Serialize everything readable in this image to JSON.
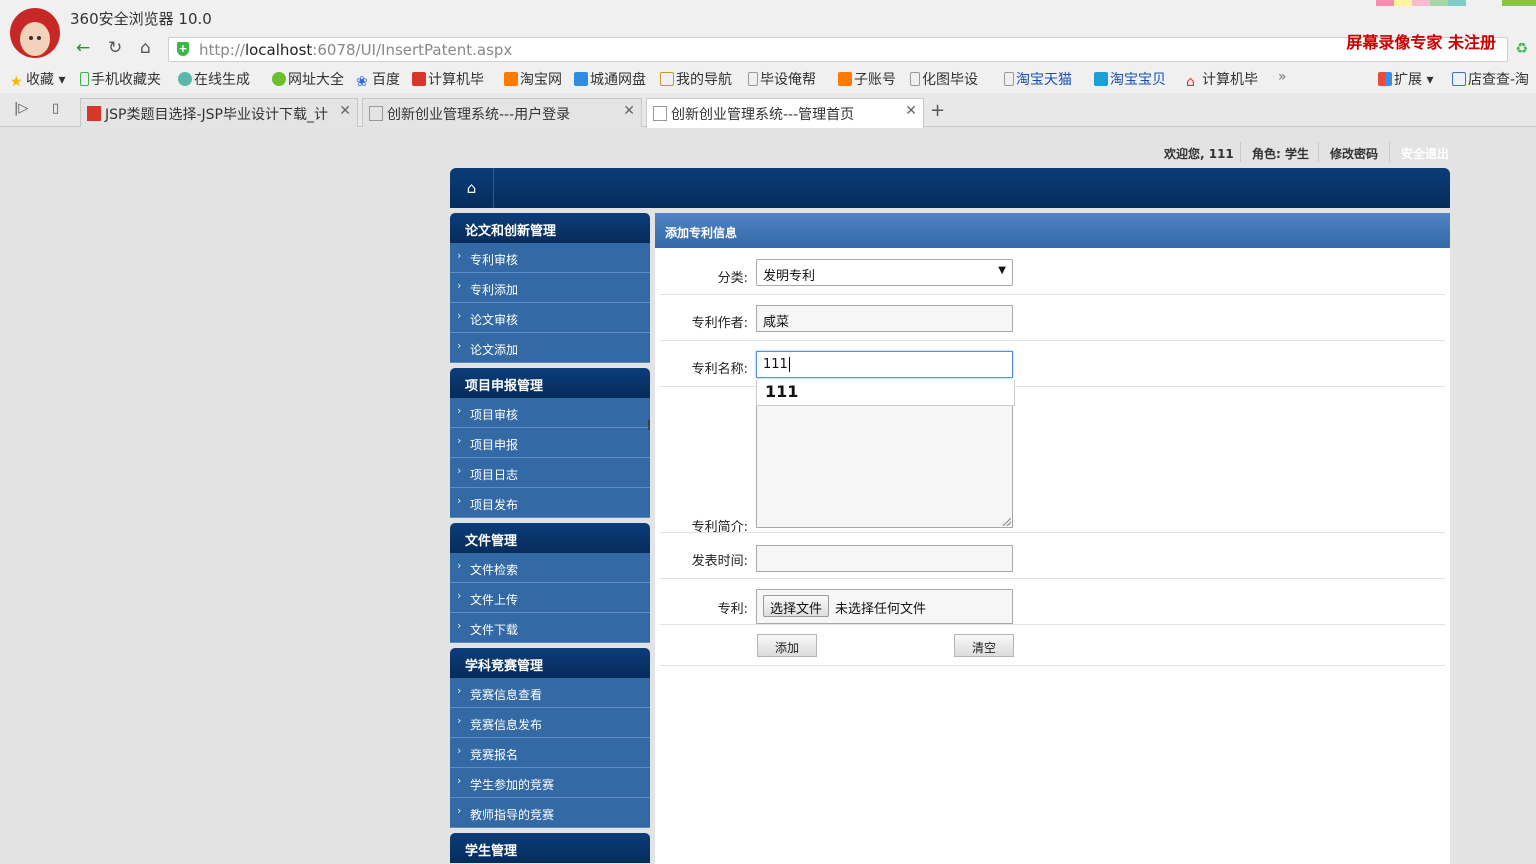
{
  "browser": {
    "title": "360安全浏览器 10.0",
    "url_protocol": "http://",
    "url_host": "localhost",
    "url_path": ":6078/UI/InsertPatent.aspx",
    "recorder_watermark": "屏幕录像专家  未注册",
    "bookmarks": [
      "收藏",
      "手机收藏夹",
      "在线生成",
      "网址大全",
      "百度",
      "计算机毕",
      "淘宝网",
      "城通网盘",
      "我的导航",
      "毕设俺帮",
      "子账号",
      "化图毕设",
      "淘宝天猫",
      "淘宝宝贝",
      "计算机毕",
      "扩展",
      "店查查-淘"
    ],
    "more_label": "»",
    "tabs": [
      {
        "label": "JSP类题目选择-JSP毕业设计下载_计"
      },
      {
        "label": "创新创业管理系统---用户登录"
      },
      {
        "label": "创新创业管理系统---管理首页"
      }
    ]
  },
  "topinfo": {
    "welcome": "欢迎您, 111",
    "role": "角色: 学生",
    "change_password": "修改密码",
    "logout": "安全退出"
  },
  "sidebar": {
    "groups": [
      {
        "title": "论文和创新管理",
        "items": [
          "专利审核",
          "专利添加",
          "论文审核",
          "论文添加"
        ]
      },
      {
        "title": "项目申报管理",
        "items": [
          "项目审核",
          "项目申报",
          "项目日志",
          "项目发布"
        ]
      },
      {
        "title": "文件管理",
        "items": [
          "文件检索",
          "文件上传",
          "文件下载"
        ]
      },
      {
        "title": "学科竞赛管理",
        "items": [
          "竞赛信息查看",
          "竞赛信息发布",
          "竞赛报名",
          "学生参加的竞赛",
          "教师指导的竞赛"
        ]
      },
      {
        "title": "学生管理",
        "items": []
      }
    ]
  },
  "form": {
    "title": "添加专利信息",
    "category_label": "分类:",
    "category_value": "发明专利",
    "author_label": "专利作者:",
    "author_value": "咸菜",
    "name_label": "专利名称:",
    "name_value": "111",
    "name_suggestion": "111",
    "intro_label": "专利简介:",
    "publish_label": "发表时间:",
    "file_label": "专利:",
    "file_button": "选择文件",
    "file_status": "未选择任何文件",
    "add_button": "添加",
    "clear_button": "清空"
  }
}
